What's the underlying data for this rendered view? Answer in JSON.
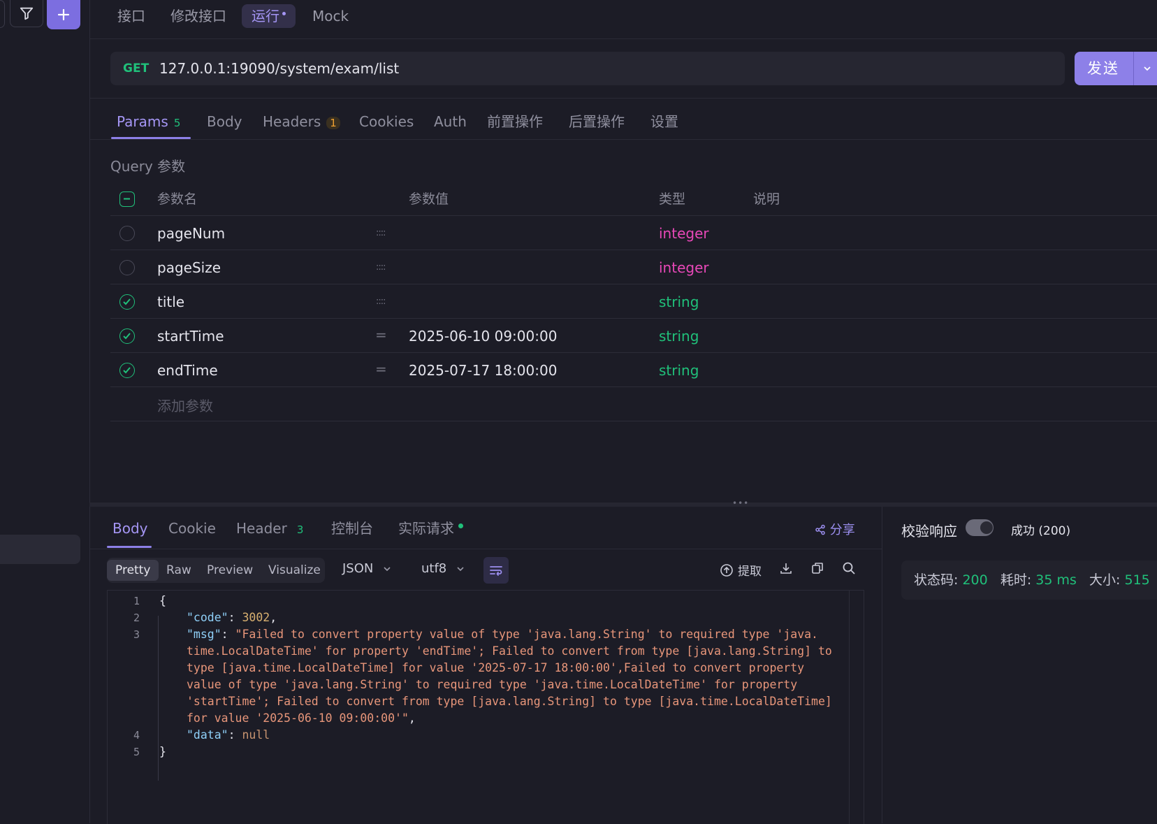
{
  "top_tabs": [
    {
      "label": "接口"
    },
    {
      "label": "修改接口"
    },
    {
      "label": "运行"
    },
    {
      "label": "Mock"
    }
  ],
  "request": {
    "method": "GET",
    "url": "127.0.0.1:19090/system/exam/list",
    "send_label": "发送"
  },
  "param_tabs": [
    {
      "label": "Params",
      "badge": "5"
    },
    {
      "label": "Body"
    },
    {
      "label": "Headers",
      "badge": "1"
    },
    {
      "label": "Cookies"
    },
    {
      "label": "Auth"
    },
    {
      "label": "前置操作"
    },
    {
      "label": "后置操作"
    },
    {
      "label": "设置"
    }
  ],
  "query": {
    "section_label": "Query 参数",
    "columns": {
      "name": "参数名",
      "value": "参数值",
      "type": "类型",
      "desc": "说明"
    },
    "rows": [
      {
        "name": "pageNum",
        "value": "",
        "type": "integer",
        "checked": false
      },
      {
        "name": "pageSize",
        "value": "",
        "type": "integer",
        "checked": false
      },
      {
        "name": "title",
        "value": "",
        "type": "string",
        "checked": true
      },
      {
        "name": "startTime",
        "value": "2025-06-10 09:00:00",
        "type": "string",
        "checked": true
      },
      {
        "name": "endTime",
        "value": "2025-07-17 18:00:00",
        "type": "string",
        "checked": true
      }
    ],
    "add_placeholder": "添加参数"
  },
  "response_tabs": [
    {
      "label": "Body"
    },
    {
      "label": "Cookie"
    },
    {
      "label": "Header",
      "badge": "3"
    },
    {
      "label": "控制台"
    },
    {
      "label": "实际请求"
    }
  ],
  "share_label": "分享",
  "view_modes": [
    "Pretty",
    "Raw",
    "Preview",
    "Visualize"
  ],
  "format": "JSON",
  "encoding": "utf8",
  "extract_label": "提取",
  "code_lines": {
    "l1": "{",
    "code_key": "\"code\"",
    "code_val": "3002",
    "msg_key": "\"msg\"",
    "msg_1": "\"Failed to convert property value of type 'java.lang.String' to required type 'java.",
    "msg_2": "time.LocalDateTime' for property 'endTime'; Failed to convert from type [java.lang.String] to",
    "msg_3": "type [java.time.LocalDateTime] for value '2025-07-17 18:00:00',Failed to convert property",
    "msg_4": "value of type 'java.lang.String' to required type 'java.time.LocalDateTime' for property",
    "msg_5": "'startTime'; Failed to convert from type [java.lang.String] to type [java.time.LocalDateTime]",
    "msg_6": "for value '2025-06-10 09:00:00'\"",
    "data_key": "\"data\"",
    "data_val": "null",
    "l5": "}"
  },
  "line_numbers": [
    "1",
    "2",
    "3",
    "4",
    "5"
  ],
  "verify_label": "校验响应",
  "status_summary": "成功 (200)",
  "stats": {
    "status_label": "状态码:",
    "status_value": "200",
    "time_label": "耗时:",
    "time_value": "35 ms",
    "size_label": "大小:",
    "size_value": "515"
  }
}
